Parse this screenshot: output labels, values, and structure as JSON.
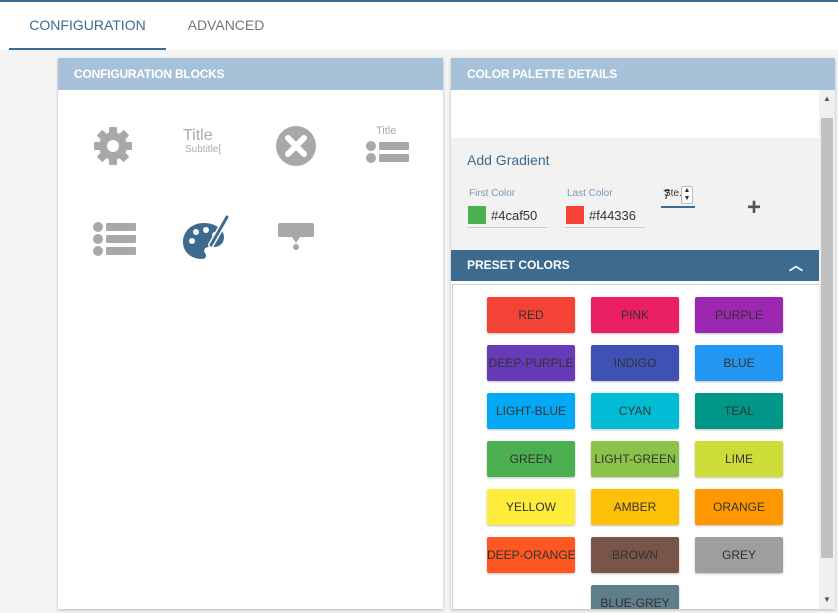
{
  "tabs": [
    {
      "label": "CONFIGURATION",
      "active": true
    },
    {
      "label": "ADVANCED",
      "active": false
    }
  ],
  "config_blocks": {
    "title": "CONFIGURATION BLOCKS",
    "title_block": {
      "title": "Title",
      "subtitle": "Subtitle["
    },
    "title_list_block": {
      "title": "Title"
    },
    "icons": [
      "gear-icon",
      "title-subtitle-icon",
      "close-circle-icon",
      "title-list-icon",
      "list-icon",
      "palette-icon",
      "tooltip-icon"
    ]
  },
  "palette_details": {
    "title": "COLOR PALETTE DETAILS",
    "add_gradient": "Add Gradient",
    "first_color": {
      "label": "First Color",
      "value": "#4caf50",
      "swatch": "#4caf50"
    },
    "last_color": {
      "label": "Last Color",
      "value": "#f44336",
      "swatch": "#f44336"
    },
    "steps": {
      "label": "Ste...",
      "value": "7"
    },
    "add_icon": "plus-icon"
  },
  "preset_colors": {
    "title": "PRESET COLORS",
    "colors": [
      {
        "name": "RED",
        "color": "#f44336"
      },
      {
        "name": "PINK",
        "color": "#e91e63"
      },
      {
        "name": "PURPLE",
        "color": "#9c27b0"
      },
      {
        "name": "DEEP-PURPLE",
        "color": "#673ab7"
      },
      {
        "name": "INDIGO",
        "color": "#3f51b5"
      },
      {
        "name": "BLUE",
        "color": "#2196f3"
      },
      {
        "name": "LIGHT-BLUE",
        "color": "#03a9f4"
      },
      {
        "name": "CYAN",
        "color": "#00bcd4"
      },
      {
        "name": "TEAL",
        "color": "#009688"
      },
      {
        "name": "GREEN",
        "color": "#4caf50"
      },
      {
        "name": "LIGHT-GREEN",
        "color": "#8bc34a"
      },
      {
        "name": "LIME",
        "color": "#cddc39"
      },
      {
        "name": "YELLOW",
        "color": "#ffeb3b"
      },
      {
        "name": "AMBER",
        "color": "#ffc107"
      },
      {
        "name": "ORANGE",
        "color": "#ff9800"
      },
      {
        "name": "DEEP-ORANGE",
        "color": "#ff5722"
      },
      {
        "name": "BROWN",
        "color": "#795548"
      },
      {
        "name": "GREY",
        "color": "#9e9e9e"
      },
      {
        "name": "BLUE-GREY",
        "color": "#607d8b"
      }
    ]
  },
  "colors": {
    "accent": "#3d6a8f",
    "header_light": "#a7c2d8",
    "icon_grey": "#a8a8a8"
  }
}
